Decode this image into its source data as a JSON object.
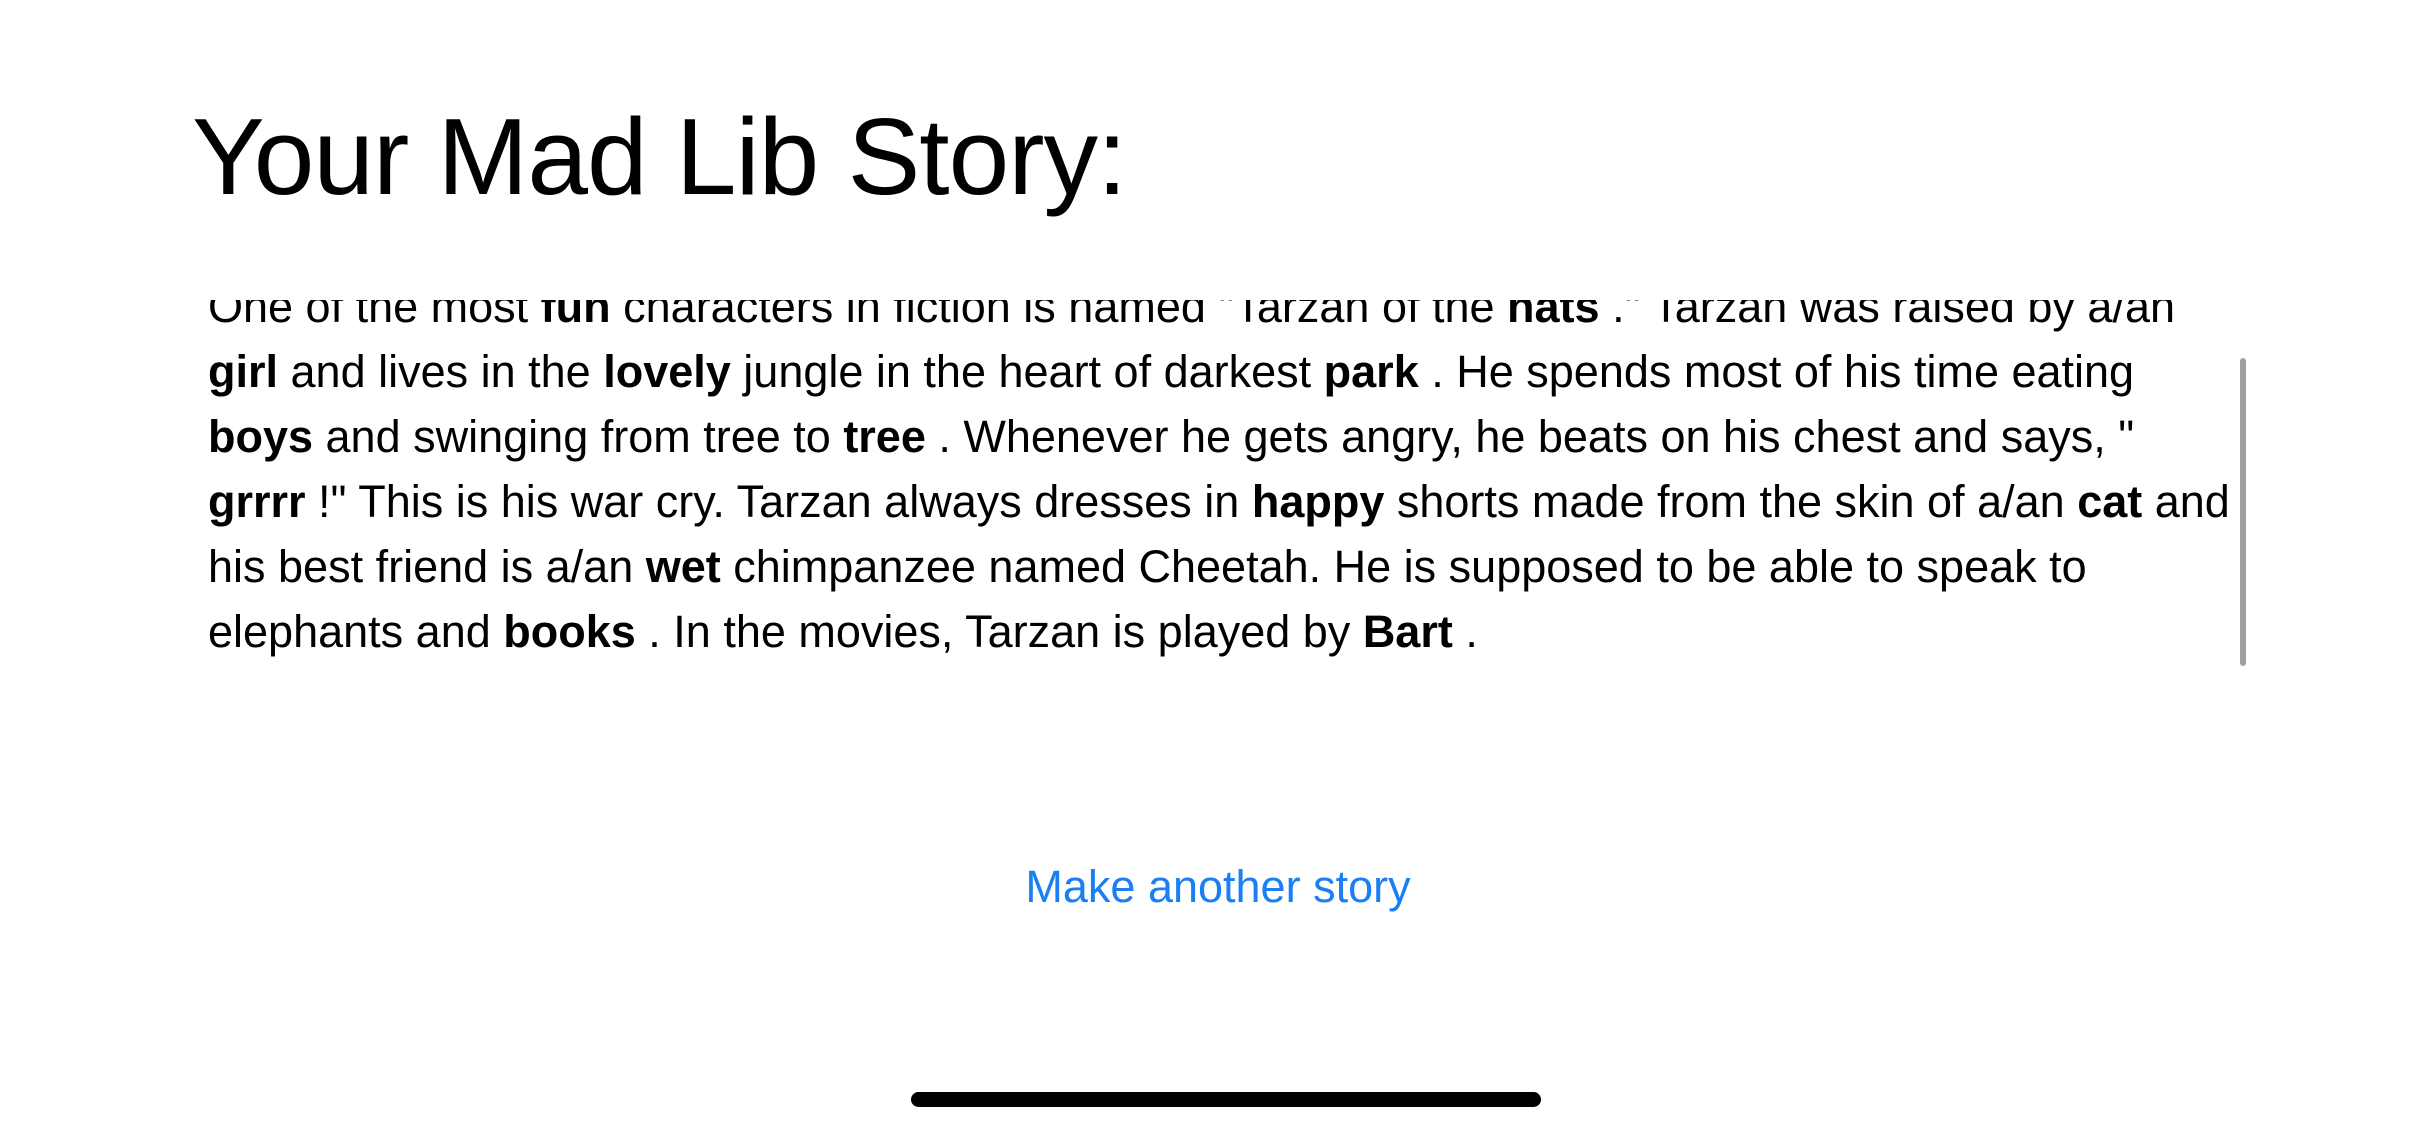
{
  "page": {
    "title": "Your Mad Lib Story:"
  },
  "story": {
    "segments": [
      {
        "text": "One of the most ",
        "filled": false
      },
      {
        "text": "fun",
        "filled": true
      },
      {
        "text": " characters in fiction is named \"Tarzan of the ",
        "filled": false
      },
      {
        "text": "hats",
        "filled": true
      },
      {
        "text": " .\" Tarzan was raised by a/an ",
        "filled": false
      },
      {
        "text": "girl",
        "filled": true
      },
      {
        "text": " and lives in the ",
        "filled": false
      },
      {
        "text": "lovely",
        "filled": true
      },
      {
        "text": " jungle in the heart of darkest ",
        "filled": false
      },
      {
        "text": "park",
        "filled": true
      },
      {
        "text": " . He spends most of his time eating ",
        "filled": false
      },
      {
        "text": "boys",
        "filled": true
      },
      {
        "text": " and swinging from tree to ",
        "filled": false
      },
      {
        "text": "tree",
        "filled": true
      },
      {
        "text": " . Whenever he gets angry, he beats on his chest and says, \" ",
        "filled": false
      },
      {
        "text": "grrrr",
        "filled": true
      },
      {
        "text": " !\" This is his war cry. Tarzan always dresses in ",
        "filled": false
      },
      {
        "text": "happy",
        "filled": true
      },
      {
        "text": " shorts made from the skin of a/an ",
        "filled": false
      },
      {
        "text": "cat",
        "filled": true
      },
      {
        "text": " and his best friend is a/an ",
        "filled": false
      },
      {
        "text": "wet",
        "filled": true
      },
      {
        "text": " chimpanzee named Cheetah. He is supposed to be able to speak to elephants and ",
        "filled": false
      },
      {
        "text": "books",
        "filled": true
      },
      {
        "text": " . In the movies, Tarzan is played by ",
        "filled": false
      },
      {
        "text": "Bart",
        "filled": true
      },
      {
        "text": " .",
        "filled": false
      }
    ]
  },
  "actions": {
    "make_another_label": "Make another story"
  },
  "colors": {
    "accent": "#1a7ff5",
    "text": "#000000",
    "background": "#ffffff",
    "scroll_indicator": "#a0a0a0"
  }
}
